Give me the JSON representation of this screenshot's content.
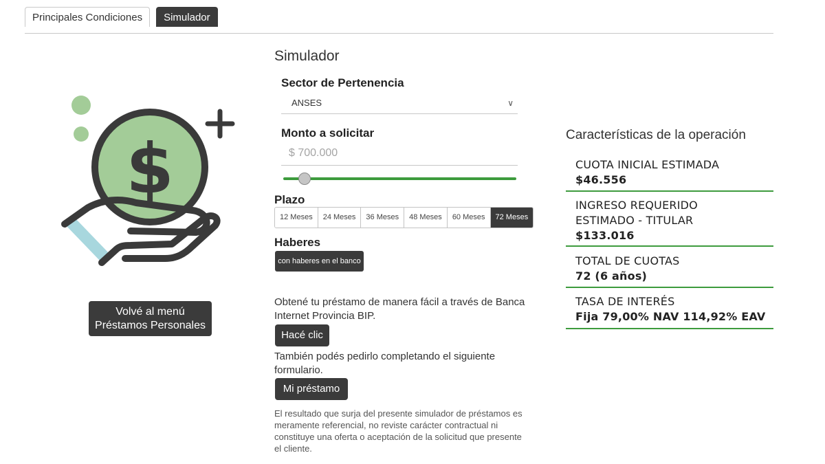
{
  "tabs": [
    {
      "label": "Principales Condiciones",
      "active": false
    },
    {
      "label": "Simulador",
      "active": true
    }
  ],
  "illustration": {
    "icon": "hand-holding-money-icon",
    "accent_color": "#a3cc98",
    "cuff_color": "#a8d7de",
    "line_color": "#3a3a3a",
    "symbol": "$"
  },
  "menu_button": {
    "line1": "Volvé al menú",
    "line2": "Préstamos Personales"
  },
  "simulator": {
    "title": "Simulador",
    "sector": {
      "label": "Sector de Pertenencia",
      "selected": "ANSES"
    },
    "amount": {
      "label": "Monto a solicitar",
      "placeholder": "$ 700.000",
      "slider_fraction": 0.09
    },
    "plazo": {
      "label": "Plazo",
      "options": [
        "12 Meses",
        "24 Meses",
        "36 Meses",
        "48 Meses",
        "60 Meses",
        "72 Meses"
      ],
      "selected": "72 Meses"
    },
    "haberes": {
      "label": "Haberes",
      "button": "con haberes en el banco"
    },
    "bip_text": "Obtené tu préstamo de manera fácil a través de Banca Internet Provincia BIP.",
    "bip_button": "Hacé clic",
    "form_text": "También podés pedirlo completando el siguiente formulario.",
    "form_button": "Mi préstamo",
    "disclaimer": "El resultado que surja del presente simulador de préstamos es meramente referencial, no reviste carácter contractual ni constituye una oferta o aceptación de la solicitud que presente el cliente."
  },
  "characteristics": {
    "title": "Características de la operación",
    "items": [
      {
        "label": "CUOTA INICIAL ESTIMADA",
        "value": "$46.556"
      },
      {
        "label": "INGRESO REQUERIDO\nESTIMADO - TITULAR",
        "value": "$133.016"
      },
      {
        "label": "TOTAL DE CUOTAS",
        "value": "72 (6 años)"
      },
      {
        "label": "TASA DE INTERÉS",
        "value": "Fija 79,00% NAV 114,92% EAV"
      }
    ]
  },
  "colors": {
    "accent_green": "#3d9b3d",
    "dark_button": "#3b3b3b"
  }
}
